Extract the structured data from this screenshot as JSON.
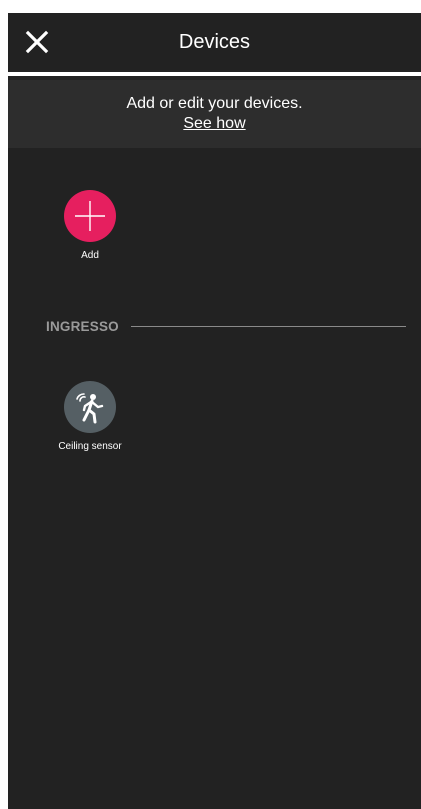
{
  "header": {
    "title": "Devices",
    "close_icon": "close-icon"
  },
  "banner": {
    "text": "Add or edit your devices.",
    "link_label": "See how"
  },
  "add_tile": {
    "label": "Add",
    "icon": "plus-icon",
    "color": "#e61f5f"
  },
  "sections": [
    {
      "name": "INGRESSO",
      "devices": [
        {
          "label": "Ceiling sensor",
          "icon": "motion-sensor-icon",
          "color": "#555f64"
        }
      ]
    }
  ],
  "colors": {
    "background": "#222222",
    "banner_background": "#2d2d2d",
    "accent": "#e61f5f",
    "section_label": "#9a9a9a"
  }
}
